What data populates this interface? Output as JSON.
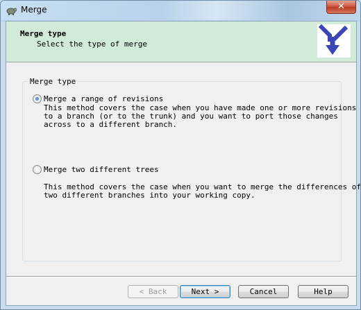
{
  "window": {
    "title": "Merge",
    "close_label": "✕"
  },
  "header": {
    "title": "Merge type",
    "subtitle": "Select the type of merge"
  },
  "group": {
    "label": "Merge type",
    "options": [
      {
        "label": "Merge a range of revisions",
        "selected": true,
        "description": "This method covers the case when you have made one or more revisions\nto a branch (or to the trunk) and you want to port those changes\nacross to a different branch."
      },
      {
        "label": "Merge two different trees",
        "selected": false,
        "description": "This method covers the case when you want to merge the differences of\ntwo different branches into your working copy."
      }
    ]
  },
  "buttons": {
    "back": "< Back",
    "next": "Next >",
    "cancel": "Cancel",
    "help": "Help"
  },
  "icons": {
    "window_icon": "tortoise-icon",
    "header_logo": "merge-arrows-icon"
  },
  "colors": {
    "header_bg": "#d2ead8",
    "logo_blue": "#3b45b4"
  }
}
